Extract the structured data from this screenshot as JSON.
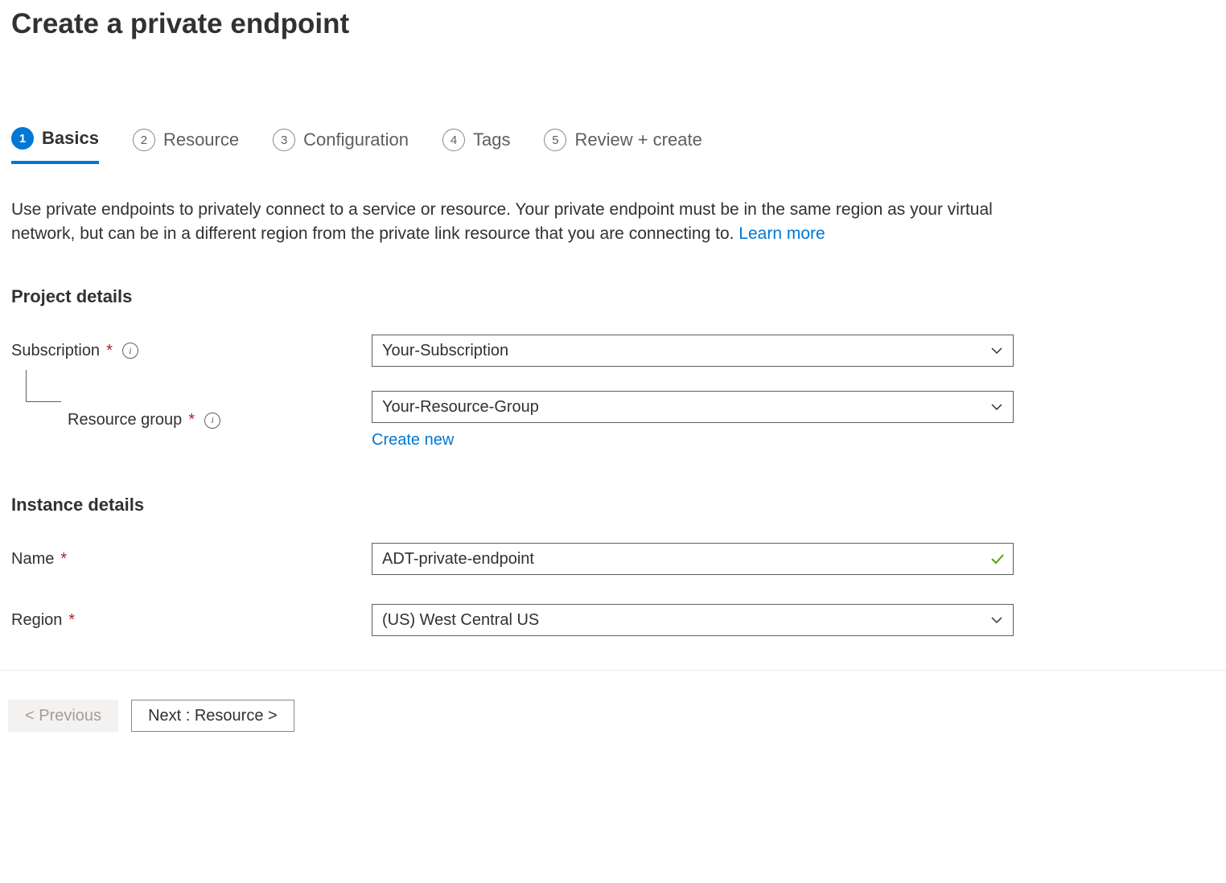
{
  "header": {
    "title": "Create a private endpoint"
  },
  "tabs": [
    {
      "number": "1",
      "label": "Basics"
    },
    {
      "number": "2",
      "label": "Resource"
    },
    {
      "number": "3",
      "label": "Configuration"
    },
    {
      "number": "4",
      "label": "Tags"
    },
    {
      "number": "5",
      "label": "Review + create"
    }
  ],
  "description": {
    "text": "Use private endpoints to privately connect to a service or resource. Your private endpoint must be in the same region as your virtual network, but can be in a different region from the private link resource that you are connecting to.  ",
    "link": "Learn more"
  },
  "sections": {
    "project_details": {
      "heading": "Project details",
      "subscription": {
        "label": "Subscription",
        "value": "Your-Subscription"
      },
      "resource_group": {
        "label": "Resource group",
        "value": "Your-Resource-Group",
        "create_new_link": "Create new"
      }
    },
    "instance_details": {
      "heading": "Instance details",
      "name": {
        "label": "Name",
        "value": "ADT-private-endpoint"
      },
      "region": {
        "label": "Region",
        "value": "(US) West Central US"
      }
    }
  },
  "footer": {
    "previous": "< Previous",
    "next": "Next : Resource >"
  }
}
